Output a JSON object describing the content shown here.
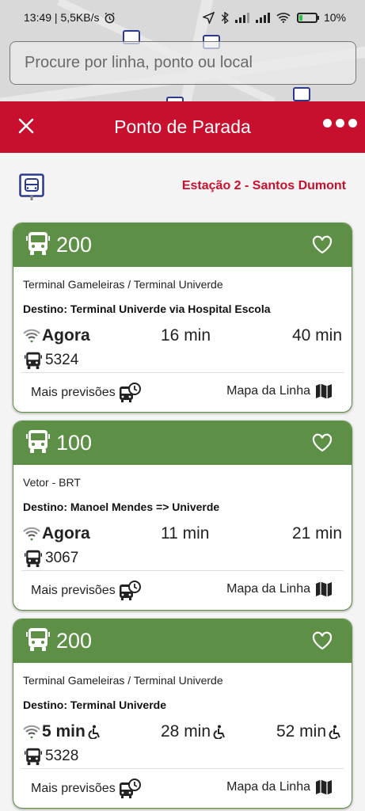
{
  "status_bar": {
    "time_speed": "13:49 | 5,5KB/s",
    "battery": "10%"
  },
  "search": {
    "placeholder": "Procure por linha, ponto ou local"
  },
  "header": {
    "title": "Ponto de Parada"
  },
  "stop": {
    "name": "Estação 2 - Santos Dumont"
  },
  "cards": [
    {
      "line": "200",
      "route": "Terminal Gameleiras / Terminal Univerde",
      "destination": "Destino: Terminal Univerde via Hospital Escola",
      "times": [
        "Agora",
        "16 min",
        "40 min"
      ],
      "accessible": false,
      "vehicle": "5324",
      "more_label": "Mais previsões",
      "map_label": "Mapa da Linha"
    },
    {
      "line": "100",
      "route": "Vetor - BRT",
      "destination": "Destino: Manoel Mendes => Univerde",
      "times": [
        "Agora",
        "11 min",
        "21 min"
      ],
      "accessible": false,
      "vehicle": "3067",
      "more_label": "Mais previsões",
      "map_label": "Mapa da Linha"
    },
    {
      "line": "200",
      "route": "Terminal Gameleiras / Terminal Univerde",
      "destination": "Destino: Terminal Univerde",
      "times": [
        "5 min",
        "28 min",
        "52 min"
      ],
      "accessible": true,
      "vehicle": "5328",
      "more_label": "Mais previsões",
      "map_label": "Mapa da Linha"
    }
  ],
  "colors": {
    "brand_red": "#c8102e",
    "line_green": "#5e8f46",
    "stop_blue": "#2b3a8c"
  }
}
